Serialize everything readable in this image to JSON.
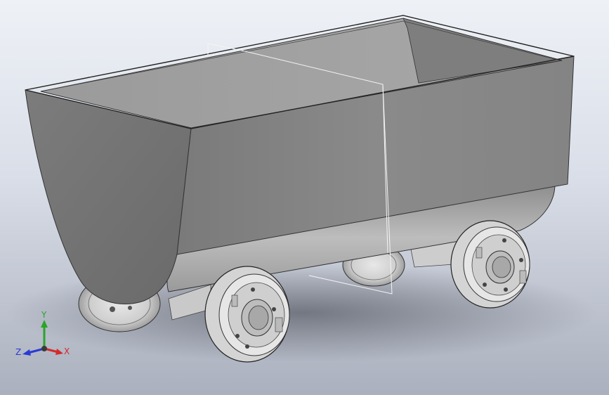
{
  "viewport": {
    "model": "mine-cart",
    "background_top": "#eef1f6",
    "background_bottom": "#aab0bd"
  },
  "triad": {
    "x_label": "X",
    "y_label": "Y",
    "z_label": "Z",
    "x_color": "#d42a2a",
    "y_color": "#2aa42a",
    "z_color": "#2a3ad4"
  }
}
